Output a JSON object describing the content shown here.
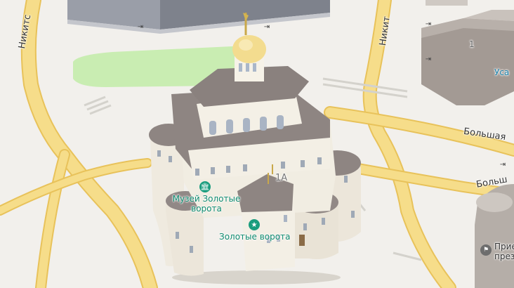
{
  "streets": {
    "nikitskaya_left": "Никитс",
    "nikitskaya_right": "Никит",
    "bolshaya_1": "Большая",
    "bolshaya_2": "Больш"
  },
  "house_numbers": {
    "main": "1А",
    "right_building": "1"
  },
  "pois": {
    "museum": "Музей Золотые ворота",
    "museum_line1": "Музей Золотые",
    "museum_line2": "ворота",
    "gate": "Золотые ворота",
    "right_top": "Уса",
    "right_bottom_line1": "Прие",
    "right_bottom_line2": "през"
  },
  "icons": {
    "museum": "museum-icon",
    "gate": "star-icon",
    "flag": "flag-icon",
    "entrance": "entrance-icon"
  },
  "colors": {
    "ground": "#f2f0ec",
    "road": "#f6dd8a",
    "road_edge": "#e8c25a",
    "park": "#c9edb2",
    "building_roof": "#8f8780",
    "building_wall": "#b9b3ad",
    "monument_wall": "#f1ede2",
    "monument_roof": "#8e8582",
    "dome": "#f3dc8f",
    "poi": "#0e8a6e"
  }
}
